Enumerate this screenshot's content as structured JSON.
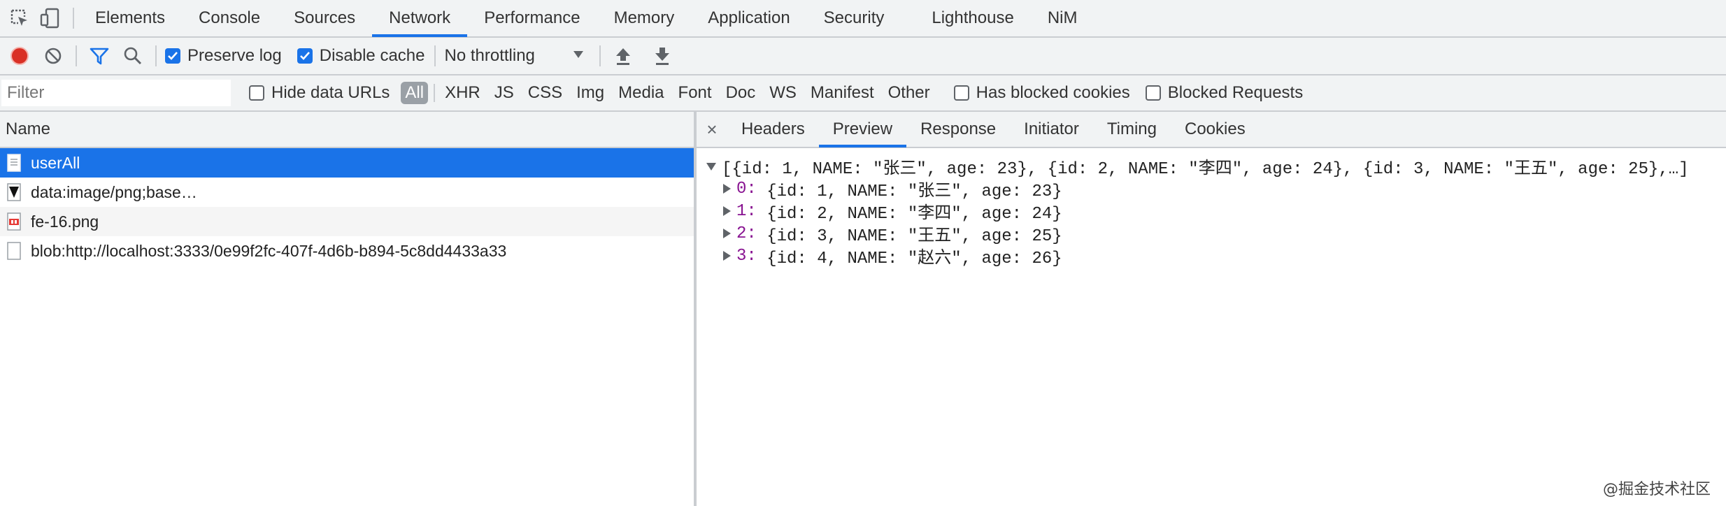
{
  "devtools": {
    "main_tabs": [
      {
        "label": "Elements",
        "active": false
      },
      {
        "label": "Console",
        "active": false
      },
      {
        "label": "Sources",
        "active": false
      },
      {
        "label": "Network",
        "active": true
      },
      {
        "label": "Performance",
        "active": false
      },
      {
        "label": "Memory",
        "active": false
      },
      {
        "label": "Application",
        "active": false
      },
      {
        "label": "Security",
        "active": false
      },
      {
        "label": "Lighthouse",
        "active": false
      },
      {
        "label": "NiM",
        "active": false
      }
    ],
    "icons": {
      "inspect": "inspect-element-icon",
      "device": "device-toolbar-icon"
    }
  },
  "toolbar": {
    "record": {
      "icon": "record-icon",
      "color": "#d93025"
    },
    "clear": {
      "icon": "clear-icon"
    },
    "filter": {
      "icon": "filter-icon",
      "color": "#1a73e8"
    },
    "search": {
      "icon": "search-icon"
    },
    "preserve_log": {
      "label": "Preserve log",
      "checked": true
    },
    "disable_cache": {
      "label": "Disable cache",
      "checked": true
    },
    "throttling": {
      "value": "No throttling"
    },
    "import": {
      "icon": "import-har-icon"
    },
    "export": {
      "icon": "export-har-icon"
    }
  },
  "filter_bar": {
    "placeholder": "Filter",
    "hide_data_urls": {
      "label": "Hide data URLs",
      "checked": false
    },
    "types": [
      "All",
      "XHR",
      "JS",
      "CSS",
      "Img",
      "Media",
      "Font",
      "Doc",
      "WS",
      "Manifest",
      "Other"
    ],
    "active_type": "All",
    "has_blocked_cookies": {
      "label": "Has blocked cookies",
      "checked": false
    },
    "blocked_requests": {
      "label": "Blocked Requests",
      "checked": false
    }
  },
  "requests": {
    "header": "Name",
    "items": [
      {
        "name": "userAll",
        "icon": "document-icon",
        "selected": true
      },
      {
        "name": "data:image/png;base…",
        "icon": "image-icon",
        "selected": false
      },
      {
        "name": "fe-16.png",
        "icon": "png-file-icon",
        "selected": false
      },
      {
        "name": "blob:http://localhost:3333/0e99f2fc-407f-4d6b-b894-5c8dd4433a33",
        "icon": "blank-file-icon",
        "selected": false
      }
    ]
  },
  "details": {
    "close": "×",
    "tabs": [
      {
        "label": "Headers",
        "active": false
      },
      {
        "label": "Preview",
        "active": true
      },
      {
        "label": "Response",
        "active": false
      },
      {
        "label": "Initiator",
        "active": false
      },
      {
        "label": "Timing",
        "active": false
      },
      {
        "label": "Cookies",
        "active": false
      }
    ],
    "preview": {
      "summary": "[{id: 1, NAME: \"张三\", age: 23}, {id: 2, NAME: \"李四\", age: 24}, {id: 3, NAME: \"王五\", age: 25},…]",
      "items": [
        {
          "key": "0",
          "value": "{id: 1, NAME: \"张三\", age: 23}"
        },
        {
          "key": "1",
          "value": "{id: 2, NAME: \"李四\", age: 24}"
        },
        {
          "key": "2",
          "value": "{id: 3, NAME: \"王五\", age: 25}"
        },
        {
          "key": "3",
          "value": "{id: 4, NAME: \"赵六\", age: 26}"
        }
      ]
    }
  },
  "watermark": "@掘金技术社区"
}
